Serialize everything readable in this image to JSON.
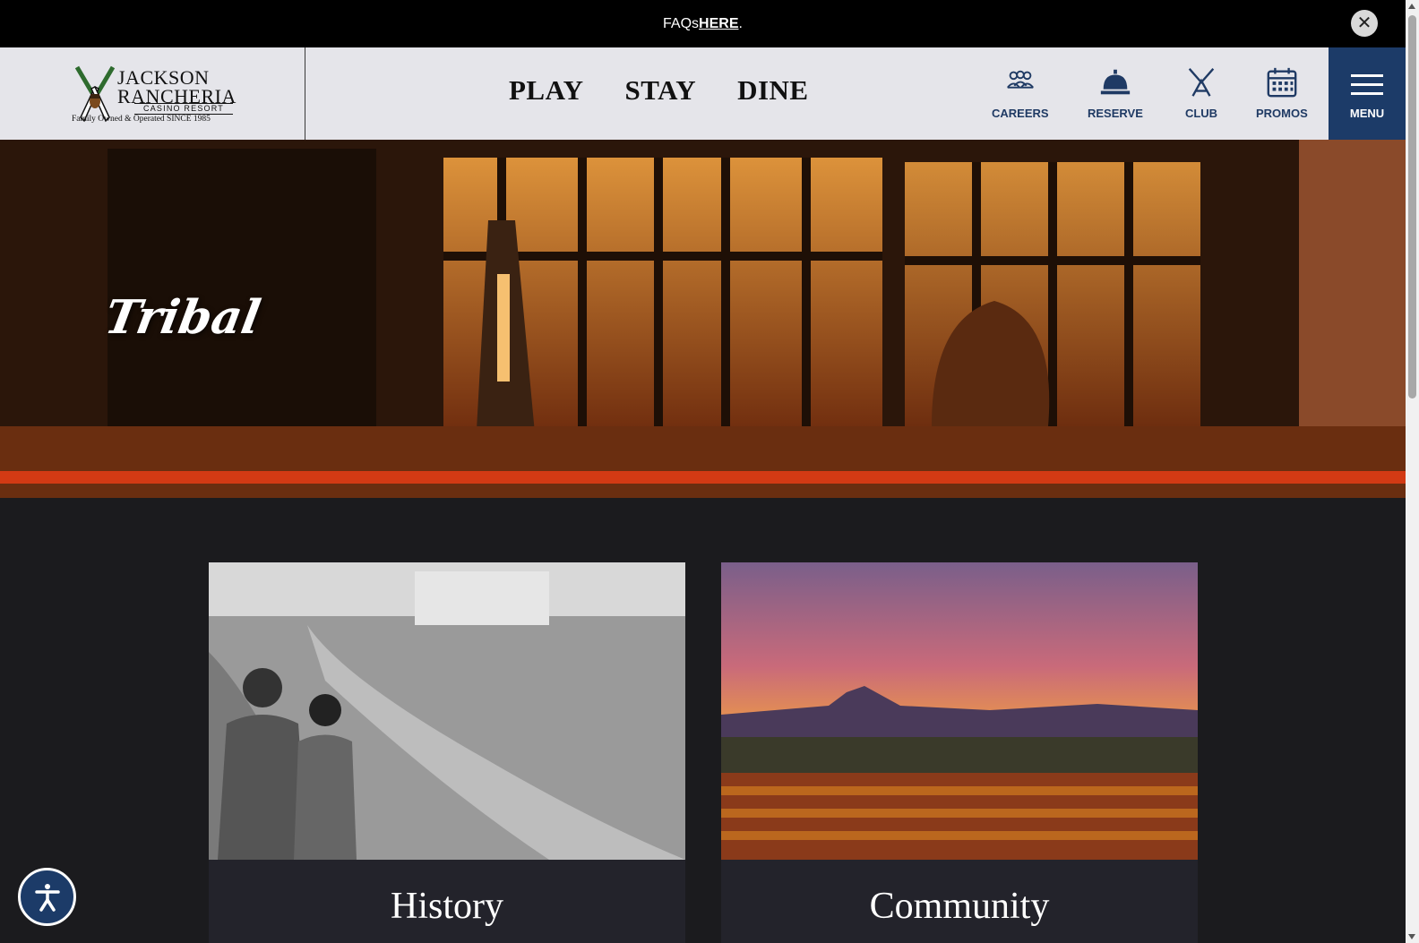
{
  "announcement": {
    "text": "FAQs ",
    "link": "HERE",
    "suffix": ".",
    "close_icon": "close-icon"
  },
  "logo": {
    "line1": "JACKSON",
    "line2": "RANCHERIA",
    "line3": "CASINO RESORT",
    "line4": "Family Owned & Operated SINCE 1985"
  },
  "main_nav": [
    {
      "label": "PLAY"
    },
    {
      "label": "STAY"
    },
    {
      "label": "DINE"
    }
  ],
  "utility_nav": [
    {
      "label": "CAREERS",
      "icon": "people-icon"
    },
    {
      "label": "RESERVE",
      "icon": "service-bell-icon"
    },
    {
      "label": "CLUB",
      "icon": "feather-icon"
    },
    {
      "label": "PROMOS",
      "icon": "calendar-icon"
    }
  ],
  "menu": {
    "label": "MENU",
    "icon": "hamburger-icon"
  },
  "hero": {
    "title": "Tribal"
  },
  "cards": [
    {
      "label": "History"
    },
    {
      "label": "Community"
    }
  ],
  "accessibility": {
    "icon": "accessibility-icon"
  },
  "colors": {
    "navy": "#1c3b68",
    "header_bg": "#e5e5ea",
    "announcement_bg": "#000000",
    "content_bg": "#1b1b1e"
  }
}
